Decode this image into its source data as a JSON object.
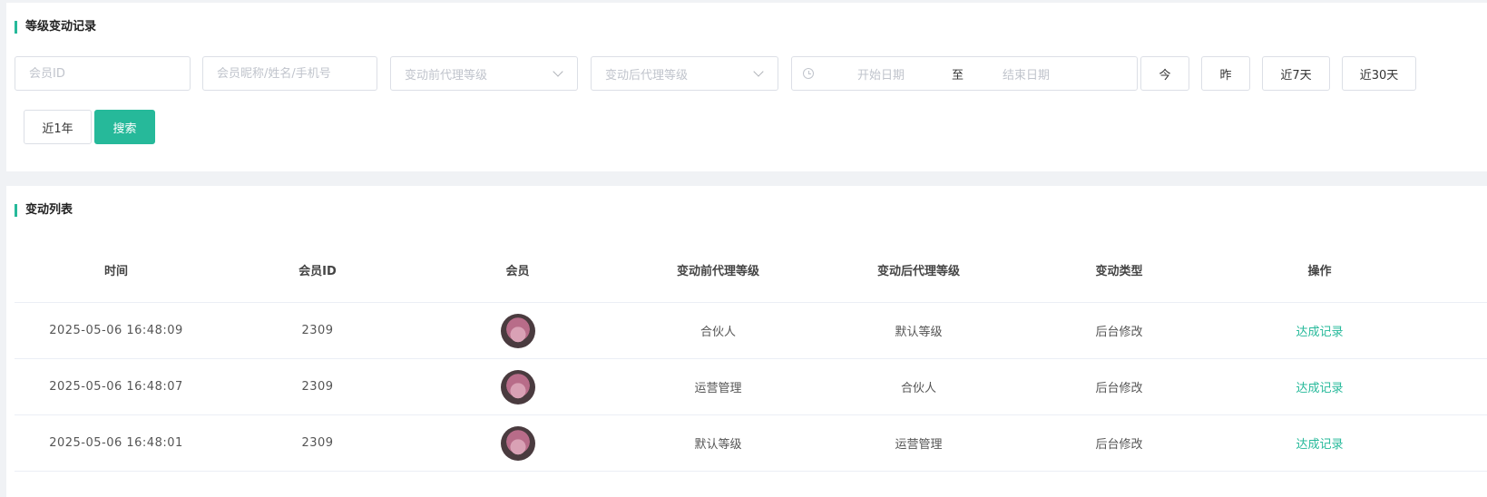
{
  "filter": {
    "title": "等级变动记录",
    "member_id_placeholder": "会员ID",
    "member_info_placeholder": "会员昵称/姓名/手机号",
    "before_level_placeholder": "变动前代理等级",
    "after_level_placeholder": "变动后代理等级",
    "start_date_placeholder": "开始日期",
    "date_separator": "至",
    "end_date_placeholder": "结束日期",
    "quick_today": "今",
    "quick_yesterday": "昨",
    "quick_7days": "近7天",
    "quick_30days": "近30天",
    "quick_1year": "近1年",
    "search_label": "搜索"
  },
  "list": {
    "title": "变动列表",
    "columns": [
      "时间",
      "会员ID",
      "会员",
      "变动前代理等级",
      "变动后代理等级",
      "变动类型",
      "操作"
    ],
    "rows": [
      {
        "time": "2025-05-06 16:48:09",
        "member_id": "2309",
        "before": "合伙人",
        "after": "默认等级",
        "type": "后台修改",
        "action": "达成记录"
      },
      {
        "time": "2025-05-06 16:48:07",
        "member_id": "2309",
        "before": "运营管理",
        "after": "合伙人",
        "type": "后台修改",
        "action": "达成记录"
      },
      {
        "time": "2025-05-06 16:48:01",
        "member_id": "2309",
        "before": "默认等级",
        "after": "运营管理",
        "type": "后台修改",
        "action": "达成记录"
      }
    ]
  },
  "colors": {
    "accent": "#26b99a",
    "border": "#dcdfe6",
    "page_bg": "#f0f2f5"
  }
}
